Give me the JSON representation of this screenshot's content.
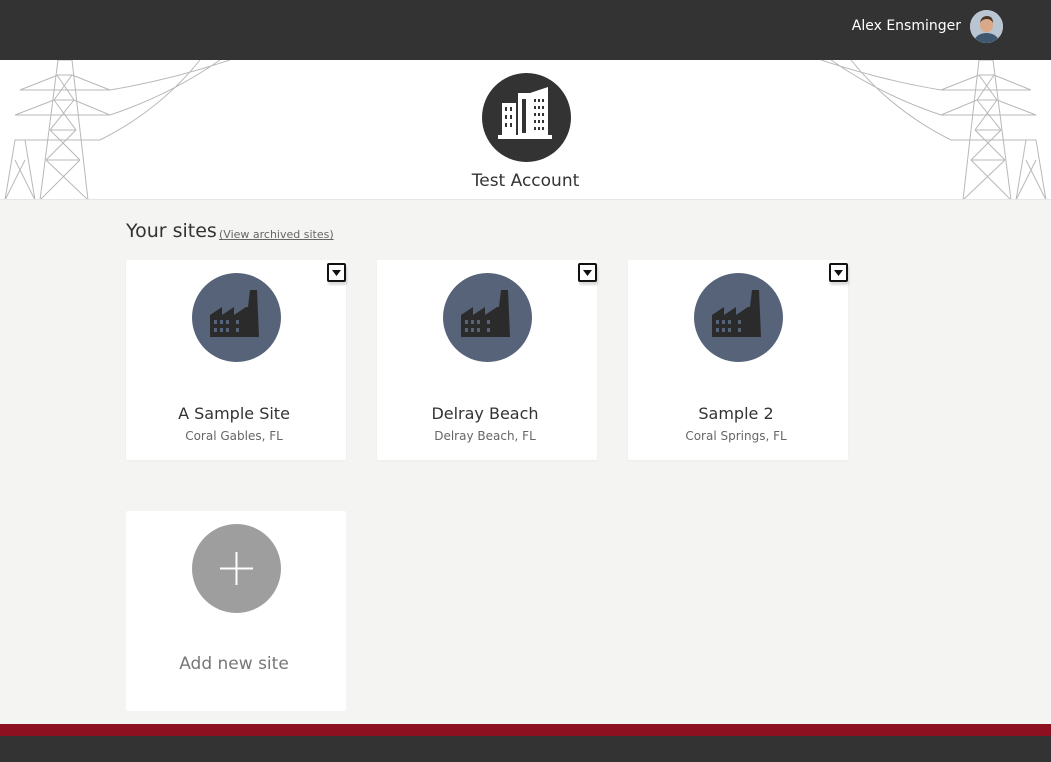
{
  "header": {
    "user_name": "Alex Ensminger",
    "avatar_icon": "user-avatar"
  },
  "account": {
    "name": "Test Account",
    "logo_icon": "building-icon"
  },
  "sites_section": {
    "title": "Your sites",
    "archived_link": "(View archived sites)"
  },
  "sites": [
    {
      "name": "A Sample Site",
      "location": "Coral Gables, FL",
      "icon": "factory-icon"
    },
    {
      "name": "Delray Beach",
      "location": "Delray Beach, FL",
      "icon": "factory-icon"
    },
    {
      "name": "Sample 2",
      "location": "Coral Springs, FL",
      "icon": "factory-icon"
    }
  ],
  "add_site": {
    "label": "Add new site",
    "icon": "plus-icon"
  },
  "colors": {
    "topbar": "#333333",
    "site_icon_bg": "#566378",
    "add_icon_bg": "#9e9e9e",
    "footer_stripe": "#8c1020",
    "page_bg": "#f4f4f2"
  }
}
